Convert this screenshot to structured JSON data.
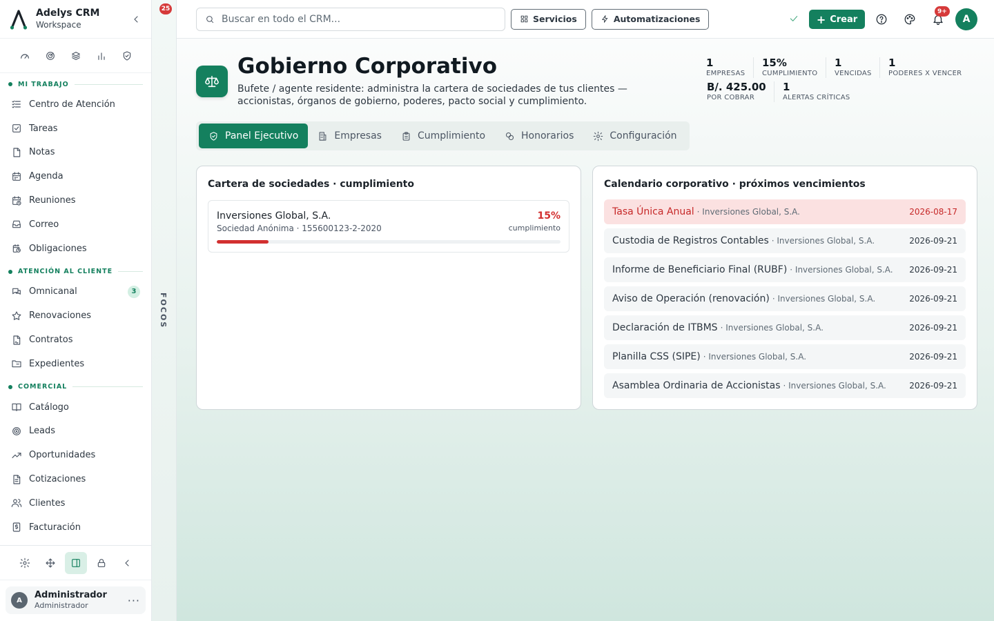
{
  "brand": {
    "name": "Adelys CRM",
    "workspace": "Workspace"
  },
  "sidebar": {
    "sections": [
      {
        "label": "MI TRABAJO",
        "items": [
          {
            "label": "Centro de Atención",
            "icon": "list-check-icon"
          },
          {
            "label": "Tareas",
            "icon": "checkbox-icon"
          },
          {
            "label": "Notas",
            "icon": "note-icon"
          },
          {
            "label": "Agenda",
            "icon": "calendar-icon"
          },
          {
            "label": "Reuniones",
            "icon": "calendar-clock-icon"
          },
          {
            "label": "Correo",
            "icon": "inbox-icon"
          },
          {
            "label": "Obligaciones",
            "icon": "obligation-clock-icon"
          }
        ]
      },
      {
        "label": "ATENCIÓN AL CLIENTE",
        "items": [
          {
            "label": "Omnicanal",
            "icon": "chat-icon",
            "badge": "3"
          },
          {
            "label": "Renovaciones",
            "icon": "star-icon"
          },
          {
            "label": "Contratos",
            "icon": "contract-icon"
          },
          {
            "label": "Expedientes",
            "icon": "folder-icon"
          }
        ]
      },
      {
        "label": "COMERCIAL",
        "items": [
          {
            "label": "Catálogo",
            "icon": "book-icon"
          },
          {
            "label": "Leads",
            "icon": "target-icon"
          },
          {
            "label": "Oportunidades",
            "icon": "trend-up-icon"
          },
          {
            "label": "Cotizaciones",
            "icon": "document-icon"
          },
          {
            "label": "Clientes",
            "icon": "users-icon"
          },
          {
            "label": "Facturación",
            "icon": "invoice-icon"
          }
        ]
      }
    ]
  },
  "user": {
    "initial": "A",
    "name": "Administrador",
    "role": "Administrador"
  },
  "focos": {
    "label": "FOCOS",
    "count": "25"
  },
  "topbar": {
    "search_placeholder": "Buscar en todo el CRM...",
    "servicios": "Servicios",
    "automatizaciones": "Automatizaciones",
    "crear": "Crear",
    "notif_badge": "9+",
    "avatar": "A"
  },
  "page": {
    "title": "Gobierno Corporativo",
    "subtitle": "Bufete / agente residente: administra la cartera de sociedades de tus clientes — accionistas, órganos de gobierno, poderes, pacto social y cumplimiento."
  },
  "kpis": {
    "empresas": {
      "value": "1",
      "label": "EMPRESAS"
    },
    "cumplimiento": {
      "value": "15%",
      "label": "CUMPLIMIENTO"
    },
    "vencidas": {
      "value": "1",
      "label": "VENCIDAS"
    },
    "poderes": {
      "value": "1",
      "label": "PODERES X VENCER"
    },
    "por_cobrar": {
      "value": "B/. 425.00",
      "label": "POR COBRAR"
    },
    "alertas": {
      "value": "1",
      "label": "ALERTAS CRÍTICAS"
    }
  },
  "tabs": [
    {
      "label": "Panel Ejecutivo",
      "icon": "shield-check-icon",
      "active": true
    },
    {
      "label": "Empresas",
      "icon": "building-icon"
    },
    {
      "label": "Cumplimiento",
      "icon": "clipboard-icon"
    },
    {
      "label": "Honorarios",
      "icon": "coins-icon"
    },
    {
      "label": "Configuración",
      "icon": "gear-icon"
    }
  ],
  "portfolio": {
    "title": "Cartera de sociedades · cumplimiento",
    "companies": [
      {
        "name": "Inversiones Global, S.A.",
        "meta": "Sociedad Anónima · 155600123-2-2020",
        "pct": "15%",
        "pct_label": "cumplimiento",
        "progress": 0.15
      }
    ]
  },
  "calendar": {
    "title": "Calendario corporativo · próximos vencimientos",
    "events": [
      {
        "name": "Tasa Única Anual",
        "company": "· Inversiones Global, S.A.",
        "date": "2026-08-17",
        "critical": true
      },
      {
        "name": "Custodia de Registros Contables",
        "company": "· Inversiones Global, S.A.",
        "date": "2026-09-21"
      },
      {
        "name": "Informe de Beneficiario Final (RUBF)",
        "company": "· Inversiones Global, S.A.",
        "date": "2026-09-21"
      },
      {
        "name": "Aviso de Operación (renovación)",
        "company": "· Inversiones Global, S.A.",
        "date": "2026-09-21"
      },
      {
        "name": "Declaración de ITBMS",
        "company": "· Inversiones Global, S.A.",
        "date": "2026-09-21"
      },
      {
        "name": "Planilla CSS (SIPE)",
        "company": "· Inversiones Global, S.A.",
        "date": "2026-09-21"
      },
      {
        "name": "Asamblea Ordinaria de Accionistas",
        "company": "· Inversiones Global, S.A.",
        "date": "2026-09-21"
      }
    ]
  },
  "colors": {
    "brand": "#14805e",
    "danger": "#d23030",
    "critical_bg": "#fbe1e1"
  }
}
